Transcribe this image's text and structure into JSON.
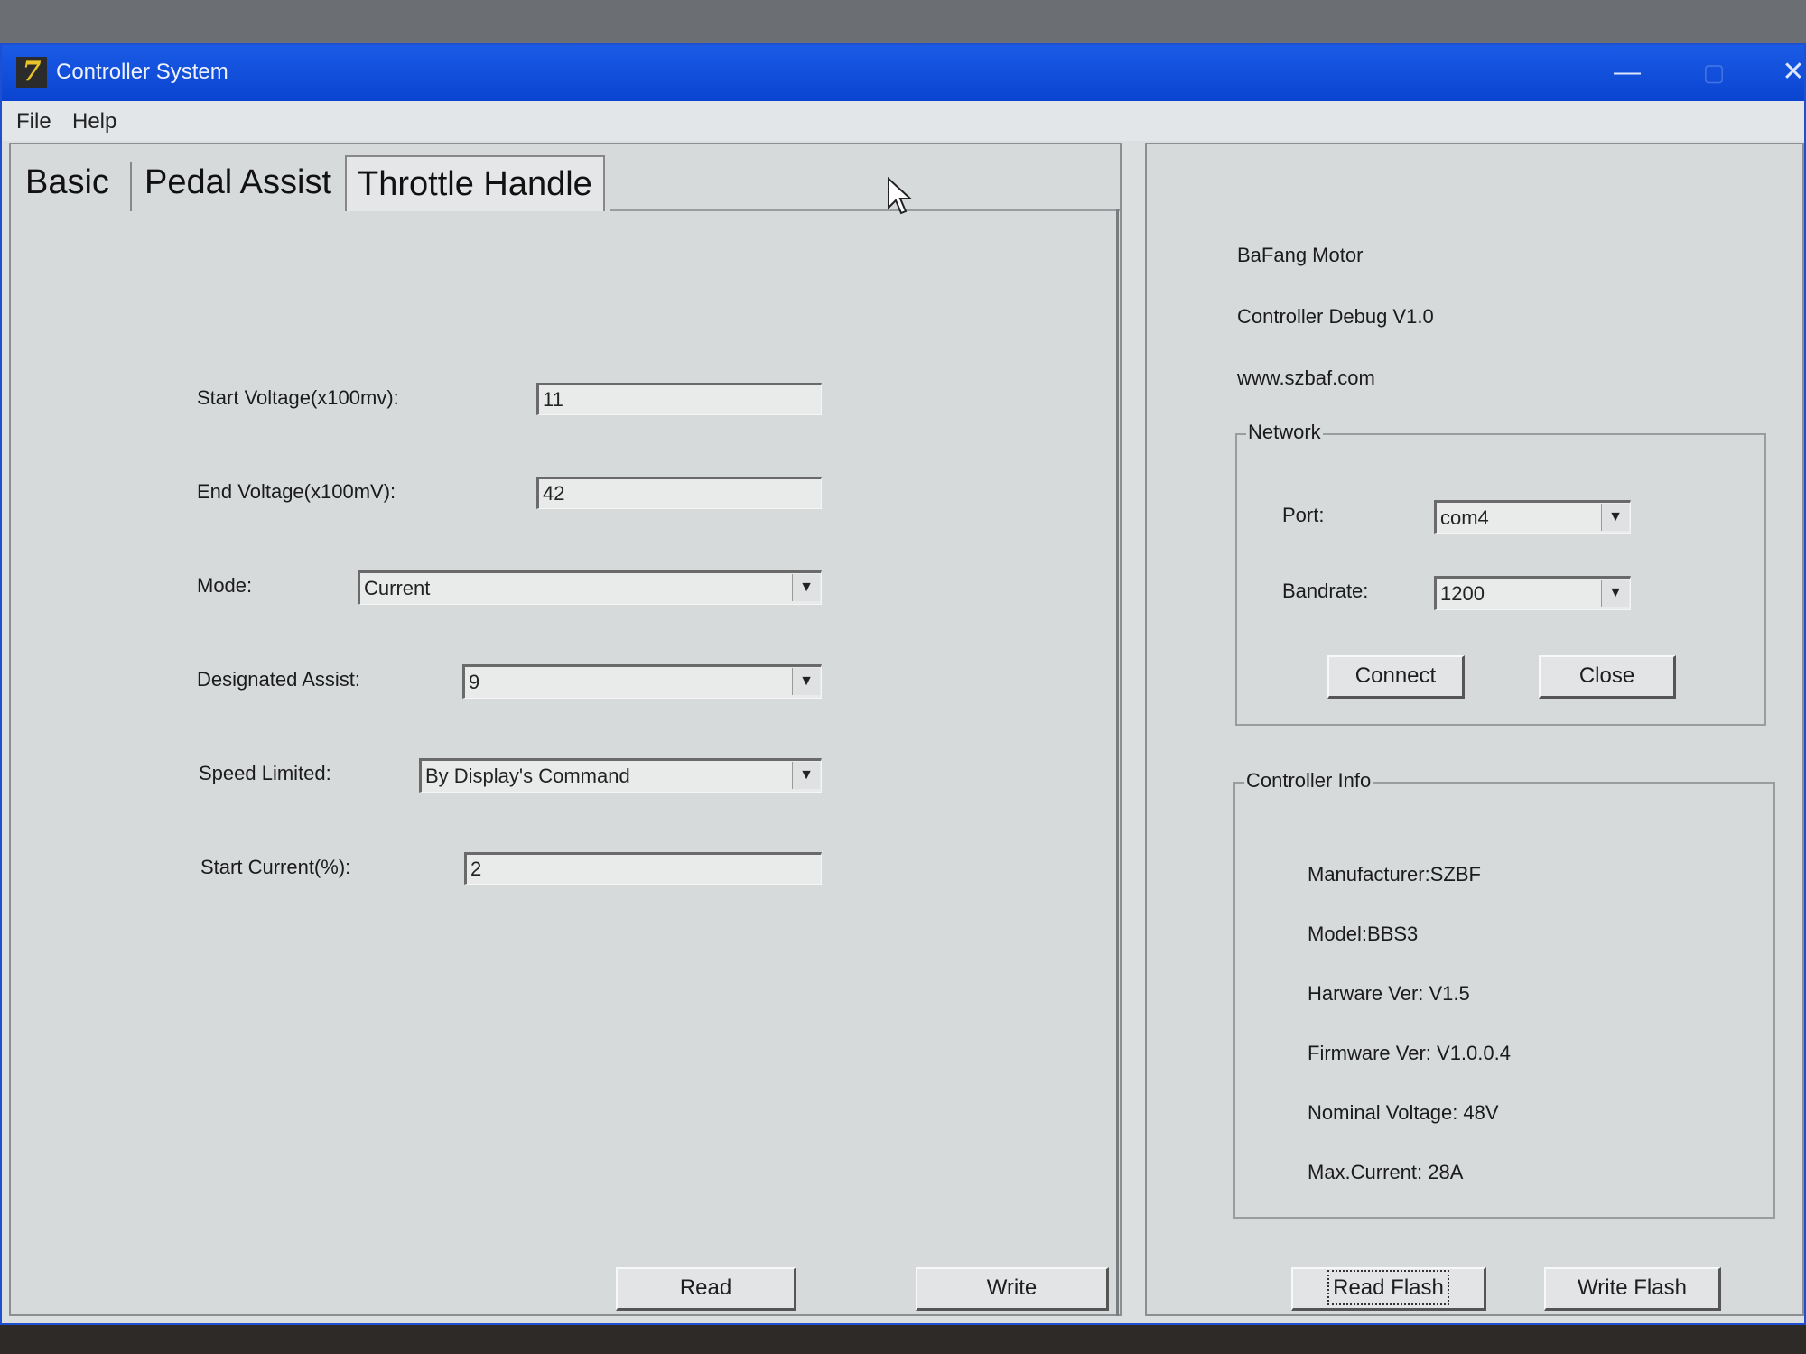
{
  "window": {
    "title": "Controller System",
    "minimize": "—",
    "maximize": "▢",
    "close": "✕"
  },
  "menu": {
    "file": "File",
    "help": "Help"
  },
  "tabs": [
    "Basic",
    "Pedal Assist",
    "Throttle Handle"
  ],
  "form": {
    "start_voltage": {
      "label": "Start Voltage(x100mv):",
      "value": "11"
    },
    "end_voltage": {
      "label": "End Voltage(x100mV):",
      "value": "42"
    },
    "mode": {
      "label": "Mode:",
      "value": "Current"
    },
    "designated_assist": {
      "label": "Designated Assist:",
      "value": "9"
    },
    "speed_limited": {
      "label": "Speed Limited:",
      "value": "By Display's Command"
    },
    "start_current": {
      "label": "Start Current(%):",
      "value": "2"
    },
    "read_button": "Read",
    "write_button": "Write"
  },
  "about": {
    "line1": "BaFang Motor",
    "line2": "Controller Debug V1.0",
    "line3": "www.szbaf.com"
  },
  "network": {
    "title": "Network",
    "port_label": "Port:",
    "port_value": "com4",
    "baud_label": "Bandrate:",
    "baud_value": "1200",
    "connect": "Connect",
    "close": "Close"
  },
  "controller_info": {
    "title": "Controller Info",
    "manufacturer": "Manufacturer:SZBF",
    "model": "Model:BBS3",
    "hardware": "Harware Ver: V1.5",
    "firmware": "Firmware Ver: V1.0.0.4",
    "voltage": "Nominal Voltage: 48V",
    "current": "Max.Current: 28A"
  },
  "flash": {
    "read": "Read Flash",
    "write": "Write Flash"
  },
  "arrow_glyph": "▼",
  "app_icon_glyph": "7"
}
